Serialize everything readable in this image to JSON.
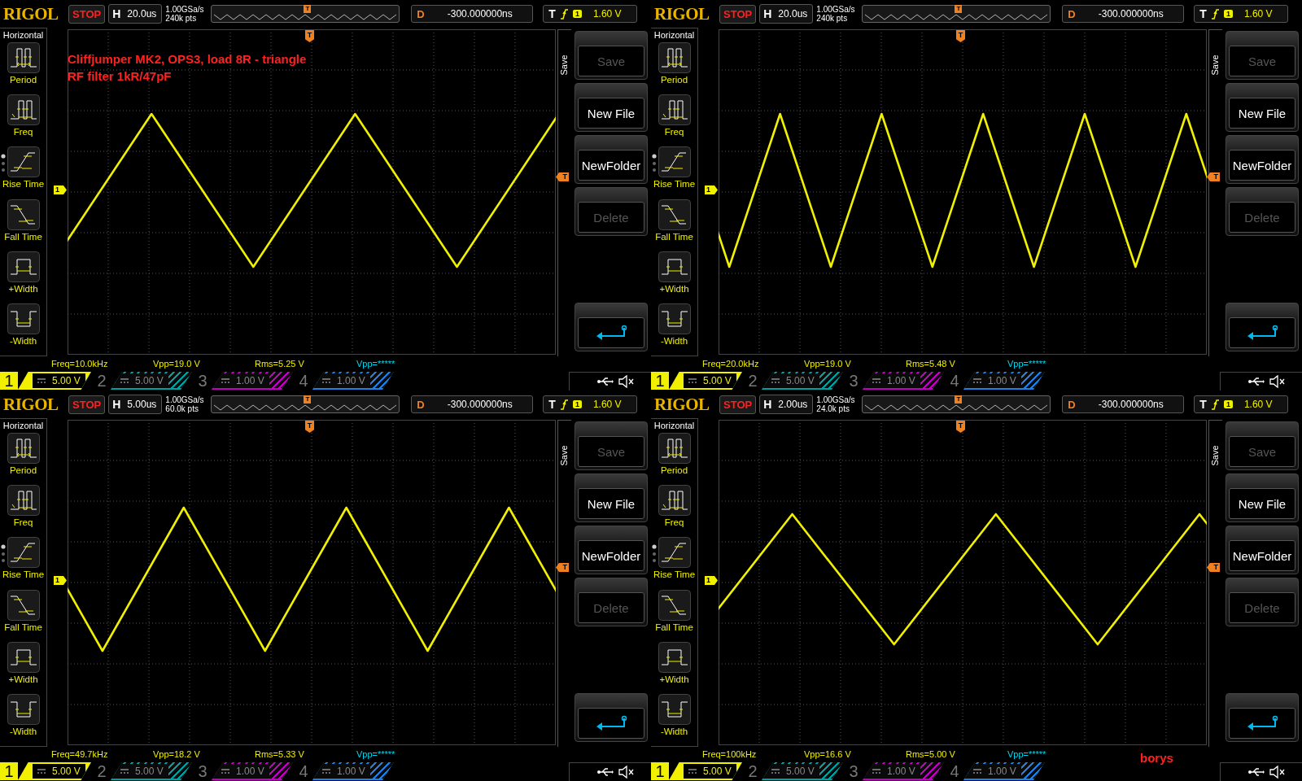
{
  "panels": [
    {
      "brand": "RIGOL",
      "run_state": "STOP",
      "timebase_label": "H",
      "timebase": "20.0us",
      "sample_rate": "1.00GSa/s",
      "memory_depth": "240k pts",
      "overview_marker": "T",
      "delay_label": "D",
      "delay": "-300.000000ns",
      "trigger_label": "T",
      "trigger_source": "1",
      "trigger_level": "1.60 V",
      "left_menu": {
        "title": "Horizontal",
        "items": [
          {
            "kind": "period",
            "label": "Period",
            "paged": false
          },
          {
            "kind": "freq",
            "label": "Freq",
            "paged": false
          },
          {
            "kind": "rise",
            "label": "Rise Time",
            "paged": true
          },
          {
            "kind": "fall",
            "label": "Fall Time",
            "paged": false
          },
          {
            "kind": "pwidth",
            "label": "+Width",
            "paged": false
          },
          {
            "kind": "nwidth",
            "label": "-Width",
            "paged": false
          }
        ]
      },
      "plot": {
        "top_marker": "T",
        "channel_marker": "1",
        "level_marker": "T",
        "annotation": [
          "Cliffjumper MK2, OPS3, load 8R - triangle",
          "RF filter 1kR/47pF"
        ]
      },
      "softkeys": {
        "tab": "Save",
        "buttons": [
          {
            "kind": "text",
            "label": "Save",
            "disabled": true
          },
          {
            "kind": "text",
            "label": "New File",
            "disabled": false
          },
          {
            "kind": "text",
            "label": "NewFolder",
            "disabled": false
          },
          {
            "kind": "text",
            "label": "Delete",
            "disabled": true
          },
          {
            "kind": "back"
          }
        ]
      },
      "measurements": [
        {
          "text": "Freq=10.0kHz",
          "color": "#f0f000"
        },
        {
          "text": "Vpp=19.0 V",
          "color": "#f0f000"
        },
        {
          "text": "Rms=5.25 V",
          "color": "#f0f000"
        },
        {
          "text": "Vpp=*****",
          "color": "#00d8f0"
        }
      ],
      "channels": [
        {
          "number": "1",
          "scale": "5.00 V",
          "active": true,
          "color": "#f0f000"
        },
        {
          "number": "2",
          "scale": "5.00 V",
          "active": false,
          "color": "#00a0a0"
        },
        {
          "number": "3",
          "scale": "1.00 V",
          "active": false,
          "color": "#c000c0"
        },
        {
          "number": "4",
          "scale": "1.00 V",
          "active": false,
          "color": "#2080e0"
        }
      ]
    },
    {
      "brand": "RIGOL",
      "run_state": "STOP",
      "timebase_label": "H",
      "timebase": "20.0us",
      "sample_rate": "1.00GSa/s",
      "memory_depth": "240k pts",
      "overview_marker": "T",
      "delay_label": "D",
      "delay": "-300.000000ns",
      "trigger_label": "T",
      "trigger_source": "1",
      "trigger_level": "1.60 V",
      "left_menu": {
        "title": "Horizontal",
        "items": [
          {
            "kind": "period",
            "label": "Period",
            "paged": false
          },
          {
            "kind": "freq",
            "label": "Freq",
            "paged": false
          },
          {
            "kind": "rise",
            "label": "Rise Time",
            "paged": true
          },
          {
            "kind": "fall",
            "label": "Fall Time",
            "paged": false
          },
          {
            "kind": "pwidth",
            "label": "+Width",
            "paged": false
          },
          {
            "kind": "nwidth",
            "label": "-Width",
            "paged": false
          }
        ]
      },
      "plot": {
        "top_marker": "T",
        "channel_marker": "1",
        "level_marker": "T"
      },
      "softkeys": {
        "tab": "Save",
        "buttons": [
          {
            "kind": "text",
            "label": "Save",
            "disabled": true
          },
          {
            "kind": "text",
            "label": "New File",
            "disabled": false
          },
          {
            "kind": "text",
            "label": "NewFolder",
            "disabled": false
          },
          {
            "kind": "text",
            "label": "Delete",
            "disabled": true
          },
          {
            "kind": "back"
          }
        ]
      },
      "measurements": [
        {
          "text": "Freq=20.0kHz",
          "color": "#f0f000"
        },
        {
          "text": "Vpp=19.0 V",
          "color": "#f0f000"
        },
        {
          "text": "Rms=5.48 V",
          "color": "#f0f000"
        },
        {
          "text": "Vpp=*****",
          "color": "#00d8f0"
        }
      ],
      "channels": [
        {
          "number": "1",
          "scale": "5.00 V",
          "active": true,
          "color": "#f0f000"
        },
        {
          "number": "2",
          "scale": "5.00 V",
          "active": false,
          "color": "#00a0a0"
        },
        {
          "number": "3",
          "scale": "1.00 V",
          "active": false,
          "color": "#c000c0"
        },
        {
          "number": "4",
          "scale": "1.00 V",
          "active": false,
          "color": "#2080e0"
        }
      ]
    },
    {
      "brand": "RIGOL",
      "run_state": "STOP",
      "timebase_label": "H",
      "timebase": "5.00us",
      "sample_rate": "1.00GSa/s",
      "memory_depth": "60.0k pts",
      "overview_marker": "T",
      "delay_label": "D",
      "delay": "-300.000000ns",
      "trigger_label": "T",
      "trigger_source": "1",
      "trigger_level": "1.60 V",
      "left_menu": {
        "title": "Horizontal",
        "items": [
          {
            "kind": "period",
            "label": "Period",
            "paged": false
          },
          {
            "kind": "freq",
            "label": "Freq",
            "paged": false
          },
          {
            "kind": "rise",
            "label": "Rise Time",
            "paged": true
          },
          {
            "kind": "fall",
            "label": "Fall Time",
            "paged": false
          },
          {
            "kind": "pwidth",
            "label": "+Width",
            "paged": false
          },
          {
            "kind": "nwidth",
            "label": "-Width",
            "paged": false
          }
        ]
      },
      "plot": {
        "top_marker": "T",
        "channel_marker": "1",
        "level_marker": "T"
      },
      "softkeys": {
        "tab": "Save",
        "buttons": [
          {
            "kind": "text",
            "label": "Save",
            "disabled": true
          },
          {
            "kind": "text",
            "label": "New File",
            "disabled": false
          },
          {
            "kind": "text",
            "label": "NewFolder",
            "disabled": false
          },
          {
            "kind": "text",
            "label": "Delete",
            "disabled": true
          },
          {
            "kind": "back"
          }
        ]
      },
      "measurements": [
        {
          "text": "Freq=49.7kHz",
          "color": "#f0f000"
        },
        {
          "text": "Vpp=18.2 V",
          "color": "#f0f000"
        },
        {
          "text": "Rms=5.33 V",
          "color": "#f0f000"
        },
        {
          "text": "Vpp=*****",
          "color": "#00d8f0"
        }
      ],
      "channels": [
        {
          "number": "1",
          "scale": "5.00 V",
          "active": true,
          "color": "#f0f000"
        },
        {
          "number": "2",
          "scale": "5.00 V",
          "active": false,
          "color": "#00a0a0"
        },
        {
          "number": "3",
          "scale": "1.00 V",
          "active": false,
          "color": "#c000c0"
        },
        {
          "number": "4",
          "scale": "1.00 V",
          "active": false,
          "color": "#2080e0"
        }
      ]
    },
    {
      "brand": "RIGOL",
      "run_state": "STOP",
      "timebase_label": "H",
      "timebase": "2.00us",
      "sample_rate": "1.00GSa/s",
      "memory_depth": "24.0k pts",
      "overview_marker": "T",
      "delay_label": "D",
      "delay": "-300.000000ns",
      "trigger_label": "T",
      "trigger_source": "1",
      "trigger_level": "1.60 V",
      "left_menu": {
        "title": "Horizontal",
        "items": [
          {
            "kind": "period",
            "label": "Period",
            "paged": false
          },
          {
            "kind": "freq",
            "label": "Freq",
            "paged": false
          },
          {
            "kind": "rise",
            "label": "Rise Time",
            "paged": true
          },
          {
            "kind": "fall",
            "label": "Fall Time",
            "paged": false
          },
          {
            "kind": "pwidth",
            "label": "+Width",
            "paged": false
          },
          {
            "kind": "nwidth",
            "label": "-Width",
            "paged": false
          }
        ]
      },
      "plot": {
        "top_marker": "T",
        "channel_marker": "1",
        "level_marker": "T"
      },
      "softkeys": {
        "tab": "Save",
        "buttons": [
          {
            "kind": "text",
            "label": "Save",
            "disabled": true
          },
          {
            "kind": "text",
            "label": "New File",
            "disabled": false
          },
          {
            "kind": "text",
            "label": "NewFolder",
            "disabled": false
          },
          {
            "kind": "text",
            "label": "Delete",
            "disabled": true
          },
          {
            "kind": "back"
          }
        ]
      },
      "measurements": [
        {
          "text": "Freq=100kHz",
          "color": "#f0f000"
        },
        {
          "text": "Vpp=16.6 V",
          "color": "#f0f000"
        },
        {
          "text": "Rms=5.00 V",
          "color": "#f0f000"
        },
        {
          "text": "Vpp=*****",
          "color": "#00d8f0"
        }
      ],
      "signature": "borys",
      "channels": [
        {
          "number": "1",
          "scale": "5.00 V",
          "active": true,
          "color": "#f0f000"
        },
        {
          "number": "2",
          "scale": "5.00 V",
          "active": false,
          "color": "#00a0a0"
        },
        {
          "number": "3",
          "scale": "1.00 V",
          "active": false,
          "color": "#c000c0"
        },
        {
          "number": "4",
          "scale": "1.00 V",
          "active": false,
          "color": "#2080e0"
        }
      ]
    }
  ]
}
